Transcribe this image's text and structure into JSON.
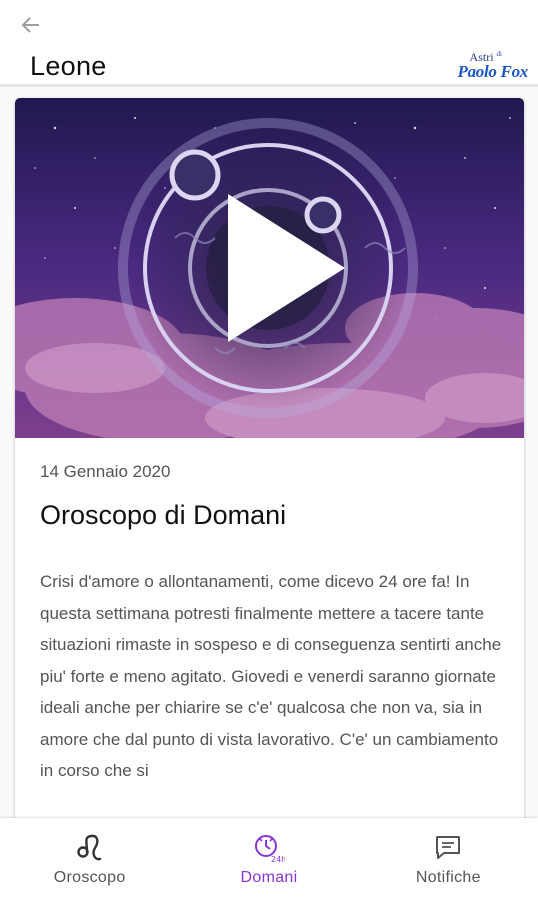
{
  "header": {
    "title": "Leone",
    "logo_line1": "Astri",
    "logo_di": "di",
    "logo_line2": "Paolo Fox"
  },
  "card": {
    "date": "14 Gennaio 2020",
    "title": "Oroscopo di Domani",
    "body": "Crisi d'amore o allontanamenti, come dicevo 24 ore fa! In questa settimana potresti finalmente mettere a tacere tante situazioni rimaste in sospeso e di conseguenza sentirti anche piu' forte e meno agitato. Giovedi e venerdi saranno giornate ideali anche per chiarire se c'e' qualcosa che non va, sia in amore che dal punto di vista lavorativo. C'e' un cambiamento in corso che si"
  },
  "nav": {
    "items": [
      {
        "label": "Oroscopo",
        "icon": "leo-icon"
      },
      {
        "label": "Domani",
        "icon": "clock-24h-icon",
        "active": true
      },
      {
        "label": "Notifiche",
        "icon": "message-icon"
      }
    ]
  },
  "colors": {
    "accent": "#8a35d6",
    "logo_blue": "#1c56c7"
  }
}
